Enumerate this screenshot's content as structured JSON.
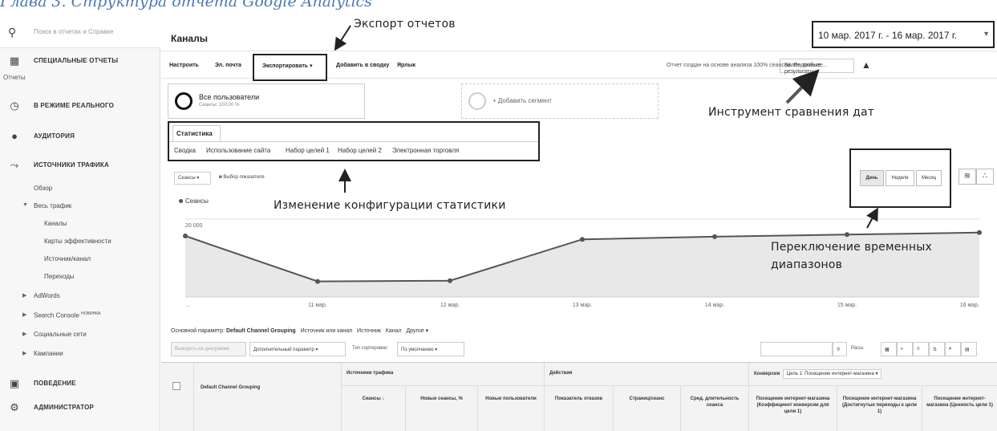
{
  "chapter_heading": "Глава 3. Структура отчета Google Analytics",
  "sidebar": {
    "search_placeholder": "Поиск в отчетах и Справке",
    "special_reports": "СПЕЦИАЛЬНЫЕ ОТЧЕТЫ",
    "reports_heading": "Отчеты",
    "realtime": "В РЕЖИМЕ РЕАЛЬНОГО",
    "audience": "АУДИТОРИЯ",
    "traffic_sources": "ИСТОЧНИКИ ТРАФИКА",
    "overview": "Обзор",
    "all_traffic": "Весь трафик",
    "channels": "Каналы",
    "treemaps": "Карты эффективности",
    "source_medium": "Источник/канал",
    "referrals": "Переходы",
    "adwords": "AdWords",
    "search_console": "Search Console",
    "new_badge": "НОВИНКА",
    "social": "Социальные сети",
    "campaigns": "Кампании",
    "behavior": "ПОВЕДЕНИЕ",
    "admin": "АДМИНИСТРАТОР"
  },
  "header": {
    "title": "Каналы",
    "date_range": "10 мар. 2017 г. - 16 мар. 2017 г."
  },
  "toolbar": {
    "customize": "Настроить",
    "email": "Эл. почта",
    "export": "Экспортировать",
    "add_to_dashboard": "Добавить в сводку",
    "shortcut": "Ярлык",
    "sampling_note": "Отчет создан на основе анализа 100% сеансов. Подробнее...",
    "precision": "Более точные результаты"
  },
  "segments": {
    "all_users": "Все пользователи",
    "all_users_sub": "Сеансы: 100,00 %",
    "add_segment": "+ Добавить сегмент"
  },
  "explorer": {
    "tab": "Статистика",
    "links": [
      "Сводка",
      "Использование сайта",
      "Набор целей 1",
      "Набор целей 2",
      "Электронная торговля"
    ]
  },
  "chart_controls": {
    "metric": "Сеансы",
    "vs": "и",
    "choose_metric": "Выбор показателя",
    "periods": [
      "День",
      "Неделя",
      "Месяц"
    ]
  },
  "annotations": {
    "export_reports": "Экспорт отчетов",
    "date_compare": "Инструмент сравнения дат",
    "config_change": "Изменение конфигурации статистики",
    "period_switch_1": "Переключение временных",
    "period_switch_2": "диапазонов"
  },
  "chart_data": {
    "type": "area",
    "series": [
      {
        "name": "Сеансы",
        "values": [
          17500,
          10800,
          10900,
          17000,
          17400,
          17700,
          18000
        ]
      }
    ],
    "x": [
      "...",
      "11 мар.",
      "12 мар.",
      "13 мар.",
      "14 мар.",
      "15 мар.",
      "16 мар."
    ],
    "ytick_labels": [
      "20 000",
      "10 000"
    ],
    "yticks": [
      20000,
      10000
    ],
    "ylim": [
      8500,
      22000
    ],
    "colors": {
      "line": "#555555",
      "fill": "#e8e8e8"
    }
  },
  "table_controls": {
    "primary_dimension_label": "Основной параметр:",
    "primary_dimension": "Default Channel Grouping",
    "other_dims": [
      "Источник или канал",
      "Источник",
      "Канал",
      "Другое"
    ],
    "plot_rows": "Выводить на диаграмме",
    "secondary_dimension": "Дополнительный параметр",
    "sort_type_label": "Тип сортировки:",
    "sort_type": "По умолчанию",
    "advanced": "Расш."
  },
  "table": {
    "col_dimension": "Default Channel Grouping",
    "group_acquisition": "Источники трафика",
    "group_behavior": "Действия",
    "group_conversions": "Конверсии",
    "goal_select": "Цель 1: Посещение интернет-магазина",
    "columns": [
      "Сеансы",
      "Новые сеансы, %",
      "Новые пользователи",
      "Показатель отказов",
      "Страниц/сеанс",
      "Сред. длительность сеанса",
      "Посещение интернет-магазина (Коэффициент конверсии для цели 1)",
      "Посещение интернет-магазина (Достигнутые переходы к цели 1)",
      "Посещение интернет-магазина (Ценность цели 1)"
    ]
  }
}
